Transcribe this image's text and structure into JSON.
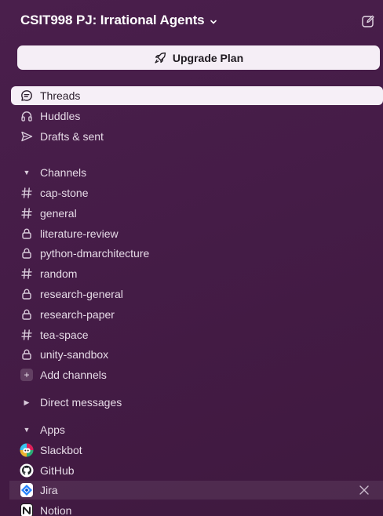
{
  "workspace": {
    "name": "CSIT998 PJ: Irrational Agents"
  },
  "upgrade": {
    "label": "Upgrade Plan"
  },
  "nav": {
    "threads": "Threads",
    "huddles": "Huddles",
    "drafts": "Drafts & sent"
  },
  "channels": {
    "header": "Channels",
    "items": [
      {
        "name": "cap-stone",
        "icon": "hash-icon"
      },
      {
        "name": "general",
        "icon": "hash-icon"
      },
      {
        "name": "literature-review",
        "icon": "lock-icon"
      },
      {
        "name": "python-dmarchitecture",
        "icon": "lock-icon"
      },
      {
        "name": "random",
        "icon": "hash-icon"
      },
      {
        "name": "research-general",
        "icon": "lock-icon"
      },
      {
        "name": "research-paper",
        "icon": "lock-icon"
      },
      {
        "name": "tea-space",
        "icon": "hash-icon"
      },
      {
        "name": "unity-sandbox",
        "icon": "lock-icon"
      }
    ],
    "add": "Add channels"
  },
  "dms": {
    "header": "Direct messages"
  },
  "apps": {
    "header": "Apps",
    "items": [
      {
        "name": "Slackbot"
      },
      {
        "name": "GitHub"
      },
      {
        "name": "Jira"
      },
      {
        "name": "Notion"
      }
    ]
  },
  "colors": {
    "sidebar_bg": "#451c47",
    "active_bg": "#f6eff7",
    "text": "#e6dbe7"
  }
}
